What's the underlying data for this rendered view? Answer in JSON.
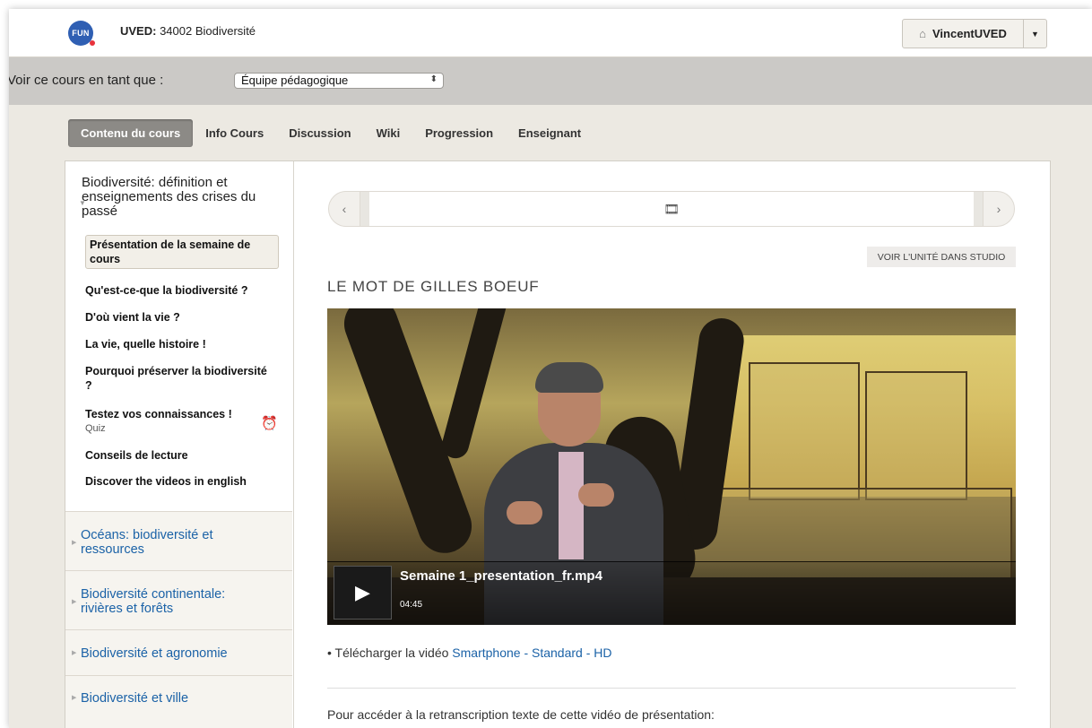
{
  "header": {
    "logo_text": "FUN",
    "course_prefix": "UVED:",
    "course_name": "34002 Biodiversité",
    "user_name": "VincentUVED",
    "user_icon": "home-icon",
    "dropdown_icon": "caret-down-icon"
  },
  "view_as": {
    "label": "Voir ce cours en tant que :",
    "selected": "Équipe pédagogique"
  },
  "tabs": [
    {
      "label": "Contenu du cours",
      "active": true
    },
    {
      "label": "Info Cours"
    },
    {
      "label": "Discussion"
    },
    {
      "label": "Wiki"
    },
    {
      "label": "Progression"
    },
    {
      "label": "Enseignant"
    }
  ],
  "sidebar": {
    "open_chapter": "Biodiversité: définition et enseignements des crises du passé",
    "sequences": [
      {
        "label": "Présentation de la semaine de cours",
        "active": true
      },
      {
        "label": "Qu'est-ce-que la biodiversité ?"
      },
      {
        "label": "D'où vient la vie ?"
      },
      {
        "label": "La vie, quelle histoire !"
      },
      {
        "label": "Pourquoi préserver la biodiversité ?"
      },
      {
        "label": "Testez vos connaissances !",
        "sub": "Quiz",
        "icon": "alarm-clock-icon"
      },
      {
        "label": "Conseils de lecture"
      },
      {
        "label": "Discover the videos in english"
      }
    ],
    "chapters": [
      {
        "label": "Océans: biodiversité et ressources"
      },
      {
        "label": "Biodiversité continentale: rivières et forêts"
      },
      {
        "label": "Biodiversité et agronomie"
      },
      {
        "label": "Biodiversité et ville"
      }
    ]
  },
  "main": {
    "nav_prev": "‹",
    "nav_next": "›",
    "studio_button": "VOIR L'UNITÉ DANS STUDIO",
    "unit_title": "LE MOT DE GILLES BOEUF",
    "video": {
      "title": "Semaine 1_presentation_fr.mp4",
      "duration": "04:45"
    },
    "download": {
      "text": "Télécharger la vidéo",
      "links": "Smartphone - Standard - HD"
    },
    "transcript_text": "Pour accéder à la retranscription texte de cette vidéo de présentation:"
  }
}
